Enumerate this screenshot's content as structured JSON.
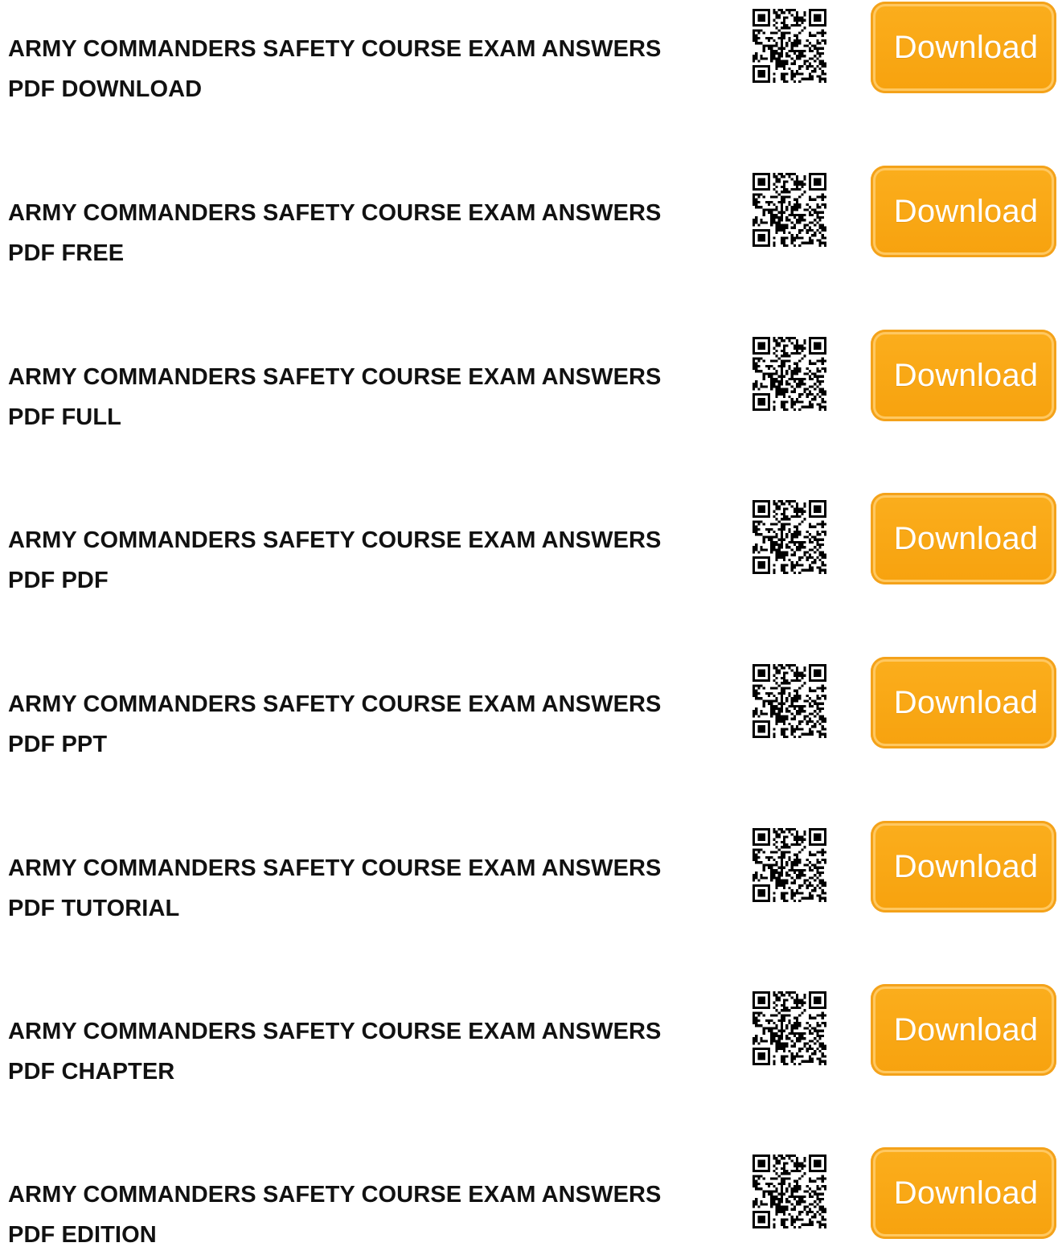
{
  "items": [
    {
      "title_line1": "ARMY COMMANDERS SAFETY COURSE EXAM ANSWERS",
      "title_line2": "PDF DOWNLOAD",
      "button_label": "Download",
      "qr_icon": "qr-code-icon"
    },
    {
      "title_line1": "ARMY COMMANDERS SAFETY COURSE EXAM ANSWERS",
      "title_line2": "PDF FREE",
      "button_label": "Download",
      "qr_icon": "qr-code-icon"
    },
    {
      "title_line1": "ARMY COMMANDERS SAFETY COURSE EXAM ANSWERS",
      "title_line2": "PDF FULL",
      "button_label": "Download",
      "qr_icon": "qr-code-icon"
    },
    {
      "title_line1": "ARMY COMMANDERS SAFETY COURSE EXAM ANSWERS",
      "title_line2": "PDF PDF",
      "button_label": "Download",
      "qr_icon": "qr-code-icon"
    },
    {
      "title_line1": "ARMY COMMANDERS SAFETY COURSE EXAM ANSWERS",
      "title_line2": "PDF PPT",
      "button_label": "Download",
      "qr_icon": "qr-code-icon"
    },
    {
      "title_line1": "ARMY COMMANDERS SAFETY COURSE EXAM ANSWERS",
      "title_line2": "PDF TUTORIAL",
      "button_label": "Download",
      "qr_icon": "qr-code-icon"
    },
    {
      "title_line1": "ARMY COMMANDERS SAFETY COURSE EXAM ANSWERS",
      "title_line2": "PDF CHAPTER",
      "button_label": "Download",
      "qr_icon": "qr-code-icon"
    },
    {
      "title_line1": "ARMY COMMANDERS SAFETY COURSE EXAM ANSWERS",
      "title_line2": "PDF EDITION",
      "button_label": "Download",
      "qr_icon": "qr-code-icon"
    }
  ],
  "colors": {
    "button_orange": "#f9a61a",
    "button_text": "#ffffff",
    "title_text": "#111111"
  }
}
